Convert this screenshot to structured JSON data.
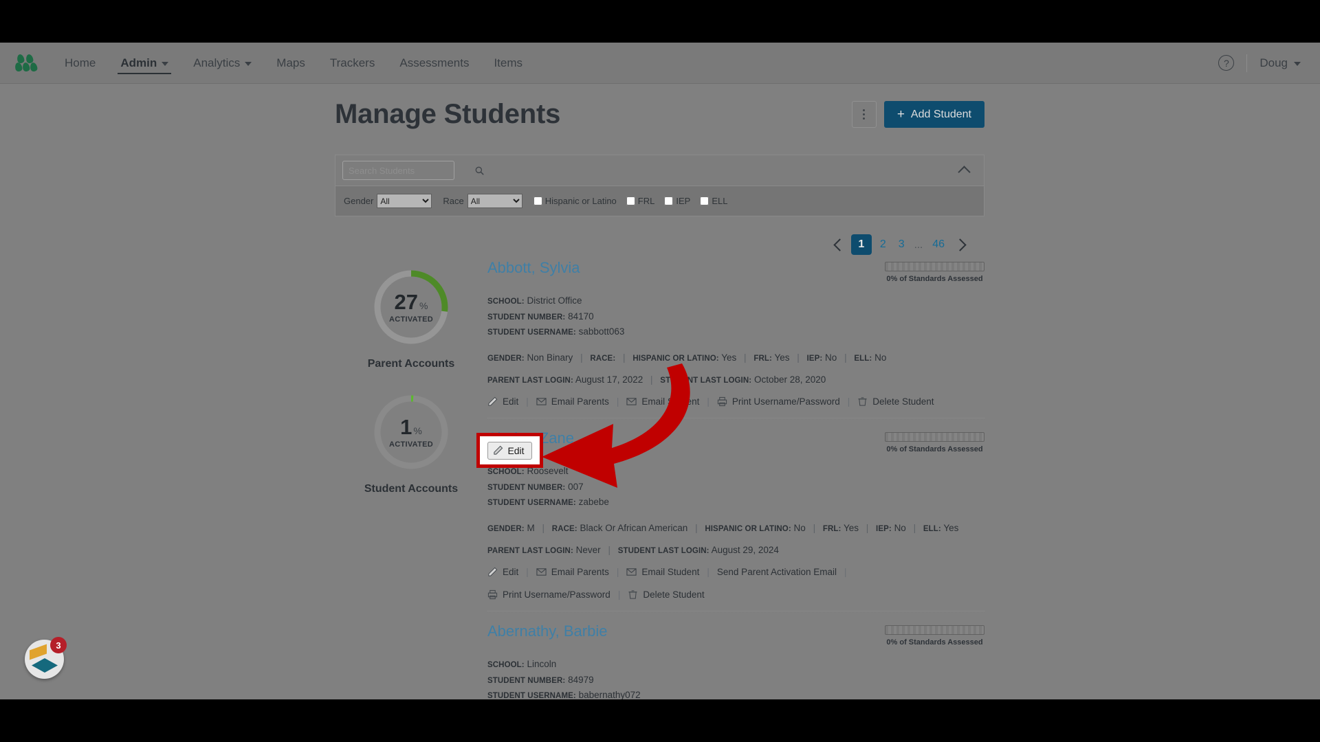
{
  "nav": {
    "logo_icon": "leaf-cluster-logo",
    "links": [
      {
        "label": "Home",
        "has_caret": false,
        "active": false
      },
      {
        "label": "Admin",
        "has_caret": true,
        "active": true
      },
      {
        "label": "Analytics",
        "has_caret": true,
        "active": false
      },
      {
        "label": "Maps",
        "has_caret": false,
        "active": false
      },
      {
        "label": "Trackers",
        "has_caret": false,
        "active": false
      },
      {
        "label": "Assessments",
        "has_caret": false,
        "active": false
      },
      {
        "label": "Items",
        "has_caret": false,
        "active": false
      }
    ],
    "help_icon": "question-mark-icon",
    "help_label": "?",
    "user_name": "Doug"
  },
  "header": {
    "title": "Manage Students",
    "kebab_icon": "more-options-icon",
    "add_student_label": "Add Student",
    "add_student_plus": "+",
    "accent_color": "#0e4c6e"
  },
  "search": {
    "placeholder": "Search Students",
    "value": "",
    "icon": "search-icon",
    "collapse_icon": "chevron-up-icon"
  },
  "filters": {
    "gender_label": "Gender",
    "gender_value": "All",
    "gender_options": [
      "All"
    ],
    "race_label": "Race",
    "race_value": "All",
    "race_options": [
      "All"
    ],
    "checkboxes": [
      {
        "label": "Hispanic or Latino",
        "checked": false
      },
      {
        "label": "FRL",
        "checked": false
      },
      {
        "label": "IEP",
        "checked": false
      },
      {
        "label": "ELL",
        "checked": false
      }
    ]
  },
  "pagination": {
    "prev_icon": "chevron-left-icon",
    "next_icon": "chevron-right-icon",
    "pages": [
      "1",
      "2",
      "3"
    ],
    "ellipsis": "...",
    "last_page": "46",
    "current": "1"
  },
  "donuts": [
    {
      "percent": 27,
      "percent_text": "27",
      "symbol": "%",
      "sub": "ACTIVATED",
      "label": "Parent Accounts",
      "arc_color": "#4e8a28",
      "track_color": "#969696"
    },
    {
      "percent": 1,
      "percent_text": "1",
      "symbol": "%",
      "sub": "ACTIVATED",
      "label": "Student Accounts",
      "arc_color": "#5cb82f",
      "track_color": "#8a8a8a"
    }
  ],
  "field_labels": {
    "school": "SCHOOL:",
    "student_number": "STUDENT NUMBER:",
    "student_username": "STUDENT USERNAME:",
    "gender": "GENDER:",
    "race": "RACE:",
    "hispanic": "HISPANIC OR LATINO:",
    "frl": "FRL:",
    "iep": "IEP:",
    "ell": "ELL:",
    "parent_last_login": "PARENT LAST LOGIN:",
    "student_last_login": "STUDENT LAST LOGIN:",
    "progress_caption": "0% of Standards Assessed",
    "separator": "|"
  },
  "action_labels": {
    "edit": "Edit",
    "email_parents": "Email Parents",
    "email_student": "Email Student",
    "send_parent_activation": "Send Parent Activation Email",
    "print_credentials": "Print Username/Password",
    "delete_student": "Delete Student"
  },
  "students": [
    {
      "name": "Abbott, Sylvia",
      "school": "District Office",
      "student_number": "84170",
      "student_username": "sabbott063",
      "gender": "Non Binary",
      "race": "",
      "hispanic": "Yes",
      "frl": "Yes",
      "iep": "No",
      "ell": "No",
      "parent_last_login": "August 17, 2022",
      "student_last_login": "October 28, 2020",
      "progress_caption": "0% of Standards Assessed",
      "progress_percent": 0
    },
    {
      "name": "Abebe, Zane",
      "school": "Roosevelt",
      "student_number": "007",
      "student_username": "zabebe",
      "gender": "M",
      "race": "Black Or African American",
      "hispanic": "No",
      "frl": "Yes",
      "iep": "No",
      "ell": "Yes",
      "parent_last_login": "Never",
      "student_last_login": "August 29, 2024",
      "progress_caption": "0% of Standards Assessed",
      "progress_percent": 0
    },
    {
      "name": "Abernathy, Barbie",
      "school": "Lincoln",
      "student_number": "84979",
      "student_username": "babernathy072",
      "progress_caption": "0% of Standards Assessed",
      "progress_percent": 0
    }
  ],
  "annotation": {
    "highlight_target": "Edit",
    "highlight_color": "#c00000",
    "arrow_color": "#c00000"
  },
  "chat_widget": {
    "badge_count": "3",
    "icon": "chat-diamond-icon",
    "badge_color": "#b51f29"
  }
}
